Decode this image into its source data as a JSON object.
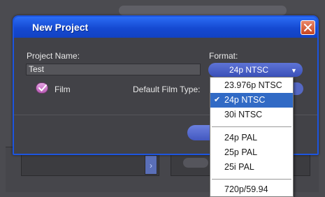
{
  "dialog": {
    "title": "New Project",
    "project_name_label": "Project Name:",
    "project_name_value": "Test",
    "format_label": "Format:",
    "format_value": "24p NTSC",
    "film_label": "Film",
    "film_checked": true,
    "default_film_type_label": "Default Film Type:"
  },
  "format_menu": {
    "options": [
      {
        "label": "23.976p NTSC",
        "selected": false
      },
      {
        "label": "24p NTSC",
        "selected": true
      },
      {
        "label": "30i NTSC",
        "selected": false
      },
      {
        "label": "24p PAL",
        "selected": false
      },
      {
        "label": "25p PAL",
        "selected": false
      },
      {
        "label": "25i PAL",
        "selected": false
      },
      {
        "label": "720p/59.94",
        "selected": false
      }
    ]
  },
  "colors": {
    "title_bar": "#1549d1",
    "close_button": "#c8451f",
    "selection": "#316ac5",
    "checkbox": "#b85cb4"
  },
  "icons": {
    "close": "close-x-icon",
    "checkbox": "checkmark-icon",
    "dropdown": "chevron-down-icon",
    "selected_option": "checkmark-icon"
  }
}
